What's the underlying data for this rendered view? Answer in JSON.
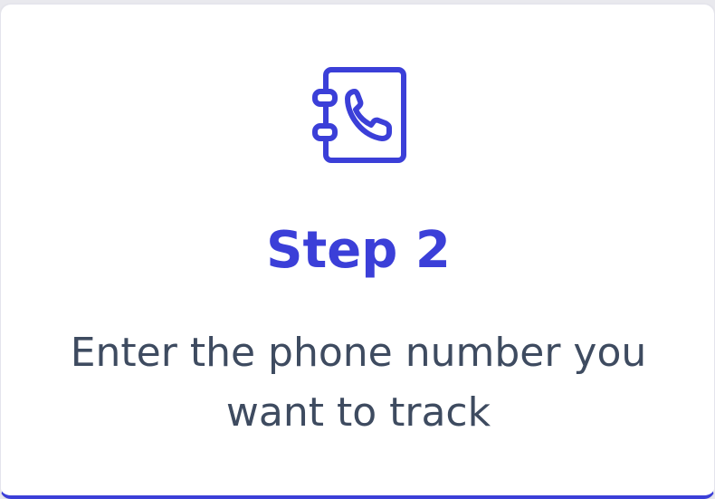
{
  "card": {
    "icon": "phone-book-icon",
    "title": "Step 2",
    "description": "Enter the phone number you want to track"
  },
  "colors": {
    "accent": "#3b3fd8",
    "text": "#3e4b60",
    "background": "#ffffff"
  }
}
